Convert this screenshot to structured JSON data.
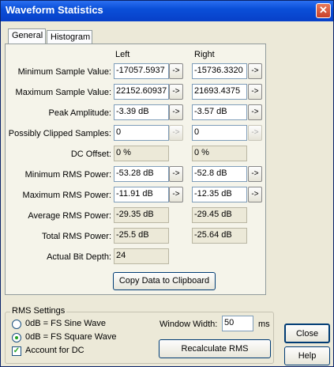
{
  "window": {
    "title": "Waveform Statistics",
    "close_glyph": "✕"
  },
  "tabs": [
    {
      "label": "General"
    },
    {
      "label": "Histogram"
    }
  ],
  "columns": {
    "left": "Left",
    "right": "Right"
  },
  "arrow_glyph": "->",
  "rows": [
    {
      "label": "Minimum Sample Value:",
      "left": "-17057.5937",
      "right": "-15736.3320"
    },
    {
      "label": "Maximum Sample Value:",
      "left": "22152.60937",
      "right": "21693.4375"
    },
    {
      "label": "Peak Amplitude:",
      "left": "-3.39 dB",
      "right": "-3.57 dB"
    },
    {
      "label": "Possibly Clipped Samples:",
      "left": "0",
      "right": "0"
    },
    {
      "label": "DC Offset:",
      "left": "0 %",
      "right": "0 %"
    },
    {
      "label": "Minimum RMS Power:",
      "left": "-53.28 dB",
      "right": "-52.8 dB"
    },
    {
      "label": "Maximum RMS Power:",
      "left": "-11.91 dB",
      "right": "-12.35 dB"
    },
    {
      "label": "Average RMS Power:",
      "left": "-29.35 dB",
      "right": "-29.45 dB"
    },
    {
      "label": "Total RMS Power:",
      "left": "-25.5 dB",
      "right": "-25.64 dB"
    },
    {
      "label": "Actual Bit Depth:",
      "left": "24"
    }
  ],
  "copy_button": "Copy Data to Clipboard",
  "rms_settings": {
    "legend": "RMS Settings",
    "sine_label": "0dB = FS Sine Wave",
    "square_label": "0dB = FS Square Wave",
    "account_dc_label": "Account for DC",
    "window_width_label": "Window Width:",
    "window_width_value": "50",
    "window_width_unit": "ms",
    "recalc_button": "Recalculate RMS"
  },
  "buttons": {
    "close": "Close",
    "help": "Help"
  }
}
